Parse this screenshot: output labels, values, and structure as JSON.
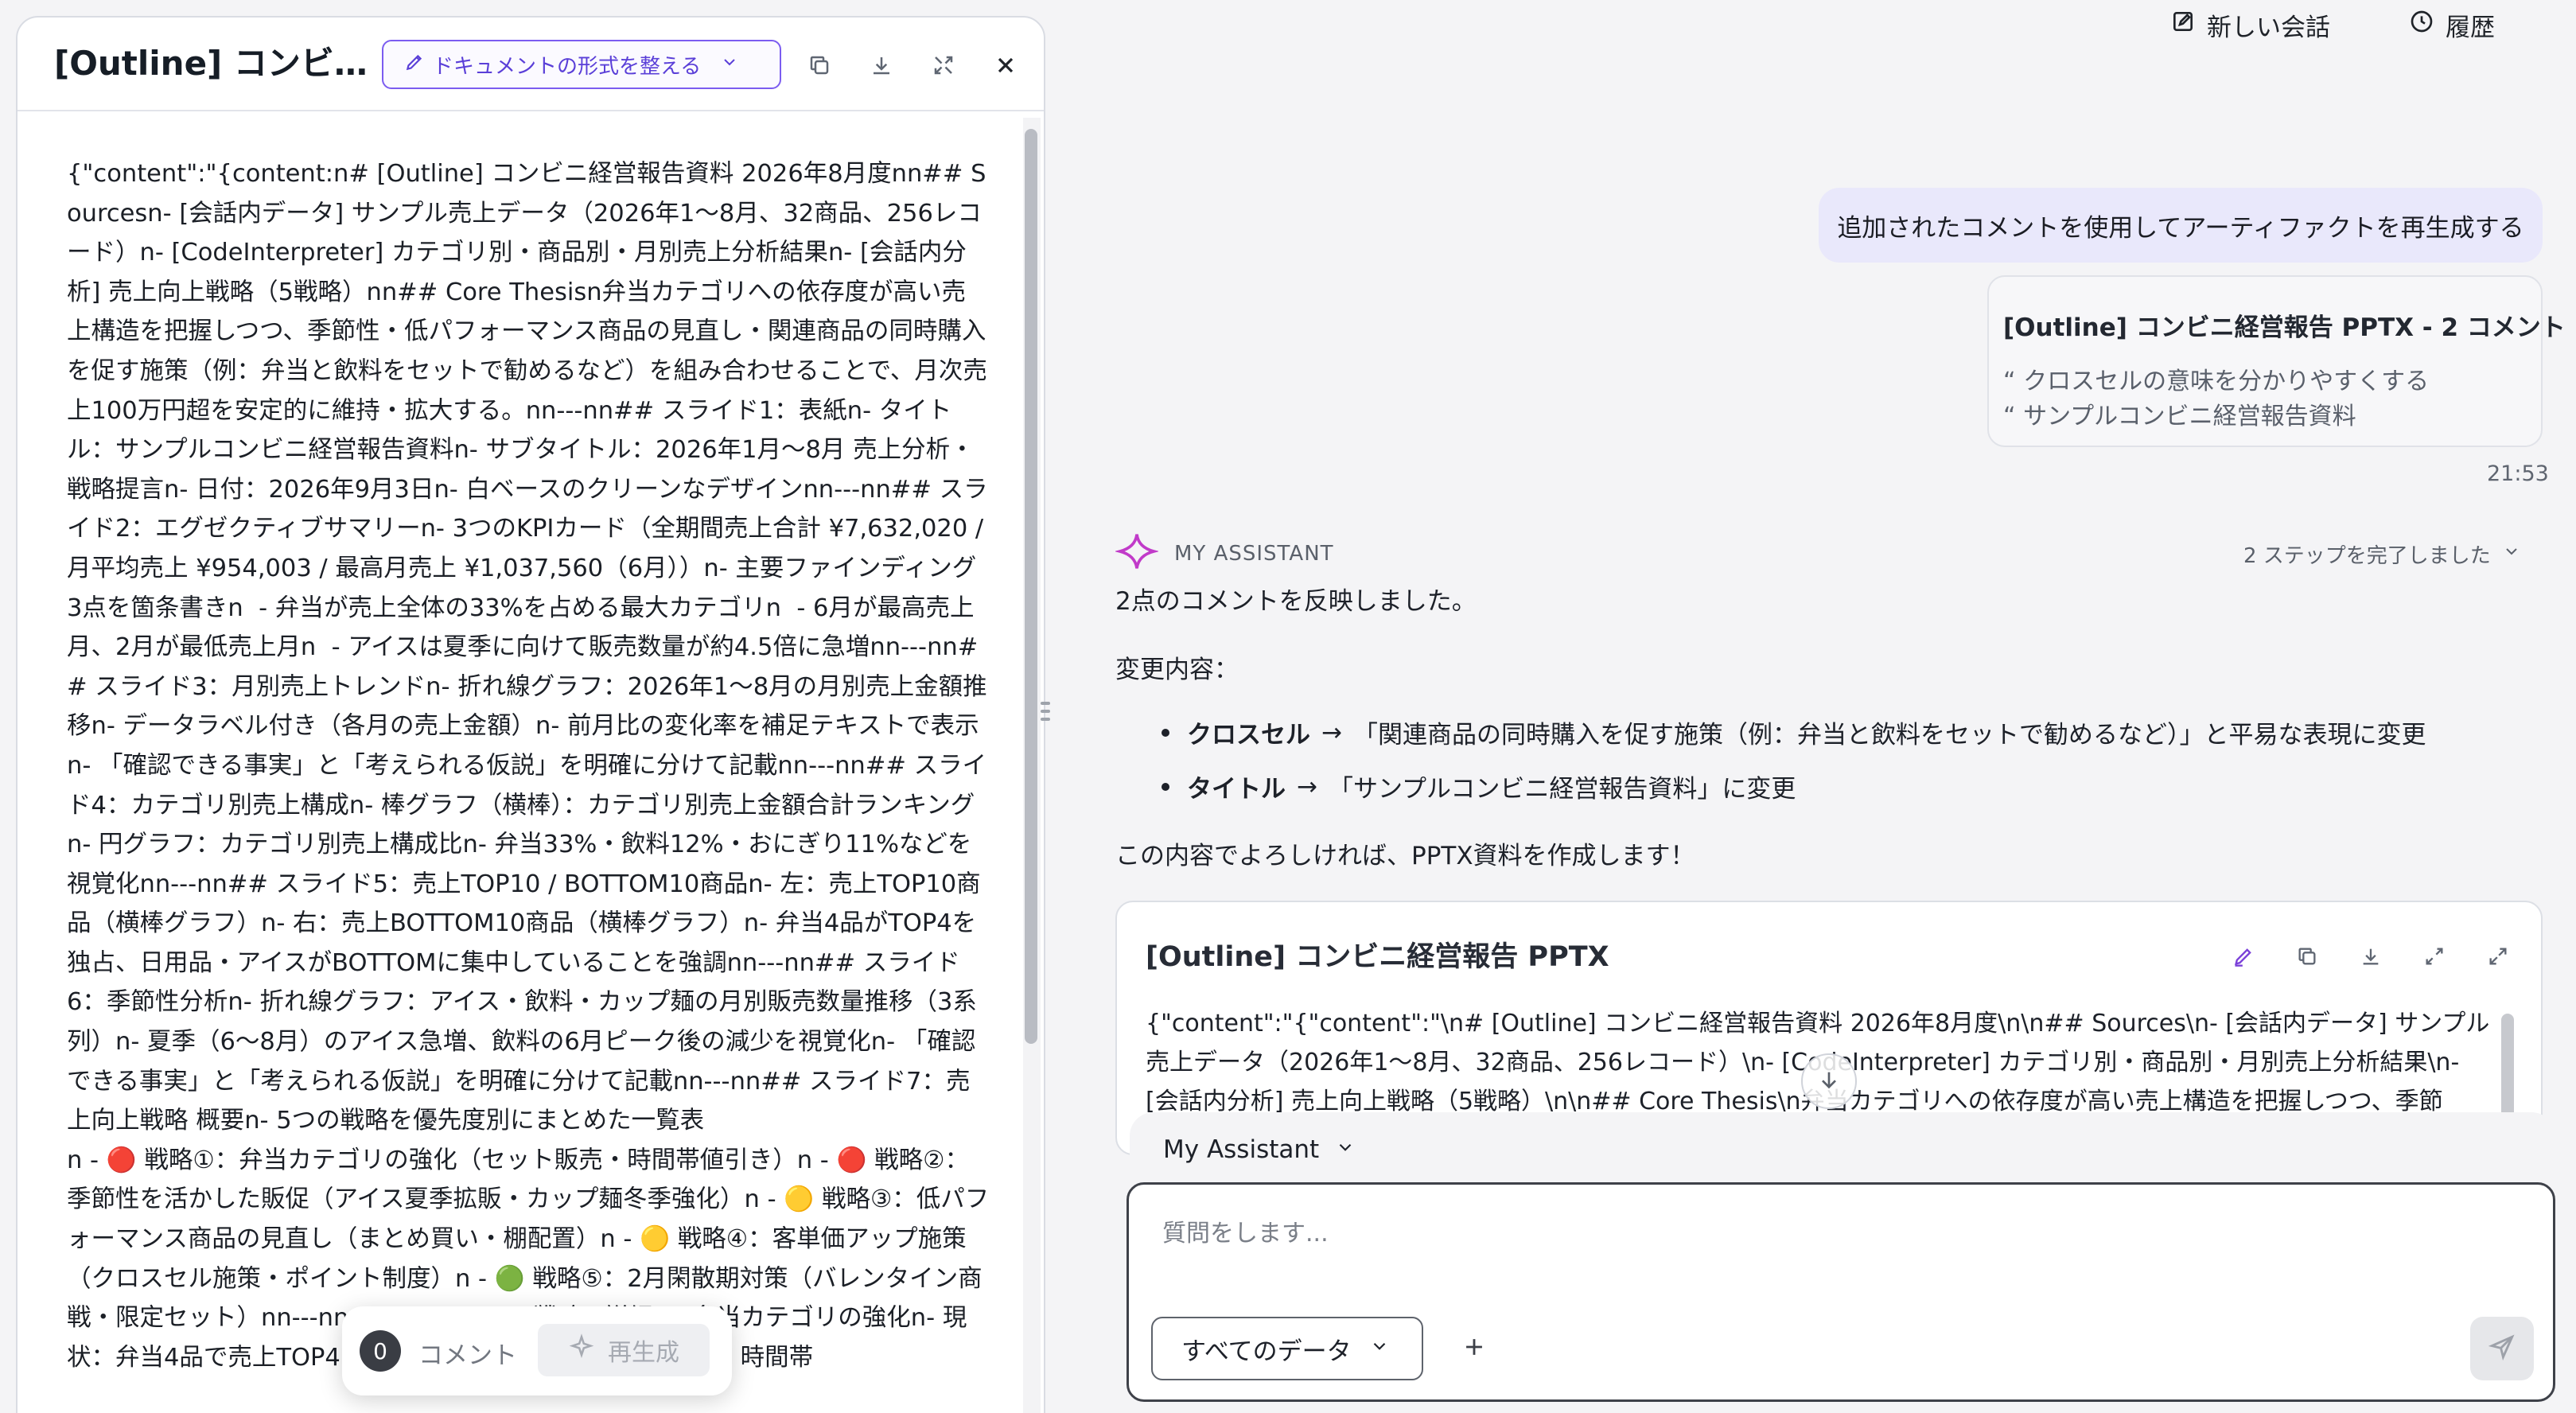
{
  "left_panel": {
    "title": "[Outline] コンビ…",
    "format_button_label": "ドキュメントの形式を整える",
    "content": "{\"content\":\"{content:n# [Outline] コンビニ経営報告資料 2026年8月度nn## Sourcesn- [会話内データ] サンプル売上データ（2026年1〜8月、32商品、256レコード）n- [CodeInterpreter] カテゴリ別・商品別・月別売上分析結果n- [会話内分析] 売上向上戦略（5戦略）nn## Core Thesisn弁当カテゴリへの依存度が高い売上構造を把握しつつ、季節性・低パフォーマンス商品の見直し・関連商品の同時購入を促す施策（例：弁当と飲料をセットで勧めるなど）を組み合わせることで、月次売上100万円超を安定的に維持・拡大する。nn---nn## スライド1：表紙n- タイトル：サンプルコンビニ経営報告資料n- サブタイトル：2026年1月〜8月 売上分析・戦略提言n- 日付：2026年9月3日n- 白ベースのクリーンなデザインnn---nn## スライド2：エグゼクティブサマリーn- 3つのKPIカード（全期間売上合計 ¥7,632,020 / 月平均売上 ¥954,003 / 最高月売上 ¥1,037,560（6月））n- 主要ファインディング3点を箇条書きn  - 弁当が売上全体の33%を占める最大カテゴリn  - 6月が最高売上月、2月が最低売上月n  - アイスは夏季に向けて販売数量が約4.5倍に急増nn---nn## スライド3：月別売上トレンドn- 折れ線グラフ：2026年1〜8月の月別売上金額推移n- データラベル付き（各月の売上金額）n- 前月比の変化率を補足テキストで表示n- 「確認できる事実」と「考えられる仮説」を明確に分けて記載nn---nn## スライド4：カテゴリ別売上構成n- 棒グラフ（横棒）：カテゴリ別売上金額合計ランキングn- 円グラフ：カテゴリ別売上構成比n- 弁当33%・飲料12%・おにぎり11%などを視覚化nn---nn## スライド5：売上TOP10 / BOTTOM10商品n- 左：売上TOP10商品（横棒グラフ）n- 右：売上BOTTOM10商品（横棒グラフ）n- 弁当4品がTOP4を独占、日用品・アイスがBOTTOMに集中していることを強調nn---nn## スライド6：季節性分析n- 折れ線グラフ：アイス・飲料・カップ麺の月別販売数量推移（3系列）n- 夏季（6〜8月）のアイス急増、飲料の6月ピーク後の減少を視覚化n- 「確認できる事実」と「考えられる仮説」を明確に分けて記載nn---nn## スライド7：売上向上戦略 概要n- 5つの戦略を優先度別にまとめた一覧表\nn - 🔴 戦略①：弁当カテゴリの強化（セット販売・時間帯値引き）n - 🔴 戦略②：季節性を活かした販促（アイス夏季拡販・カップ麺冬季強化）n - 🟡 戦略③：低パフォーマンス商品の見直し（まとめ買い・棚配置）n - 🟡 戦略④：客単価アップ施策（クロスセル施策・ポイント制度）n - 🟢 戦略⑤：2月閑散期対策（バレンタイン商戦・限定セット）nn---nn## スライド8：戦略①詳細 — 弁当カテゴリの強化n- 現状：弁当4品で売上TOP4を独占、全体の33%n- アクション：時間帯",
    "comment_count": "0",
    "comment_label": "コメント",
    "regenerate_label": "再生成"
  },
  "header": {
    "new_chat_label": "新しい会話",
    "history_label": "履歴"
  },
  "user_message": {
    "text": "追加されたコメントを使用してアーティファクトを再生成する",
    "ref_title": "[Outline] コンビニ経営報告 PPTX - 2 コメント",
    "ref_comments": [
      "“ クロスセルの意味を分かりやすくする",
      "“ サンプルコンビニ経営報告資料"
    ],
    "time": "21:53"
  },
  "assistant": {
    "name": "MY ASSISTANT",
    "steps_label": "2 ステップを完了しました",
    "intro": "2点のコメントを反映しました。",
    "changes_heading": "変更内容：",
    "changes": [
      {
        "term": "クロスセル",
        "arrow": "→",
        "desc": "「関連商品の同時購入を促す施策（例：弁当と飲料をセットで勧めるなど）」と平易な表現に変更"
      },
      {
        "term": "タイトル",
        "arrow": "→",
        "desc": "「サンプルコンビニ経営報告資料」に変更"
      }
    ],
    "closing": "この内容でよろしければ、PPTX資料を作成します！"
  },
  "artifact": {
    "title": "[Outline] コンビニ経営報告 PPTX",
    "content": "{\"content\":\"{\"content\":\"\\n# [Outline] コンビニ経営報告資料 2026年8月度\\n\\n## Sources\\n- [会話内データ] サンプル売上データ（2026年1〜8月、32商品、256レコード）\\n- [CodeInterpreter] カテゴリ別・商品別・月別売上分析結果\\n- [会話内分析] 売上向上戦略（5戦略）\\n\\n## Core Thesis\\n弁当カテゴリへの依存度が高い売上構造を把握しつつ、季節"
  },
  "composer": {
    "agent_label": "My Assistant",
    "placeholder": "質問をします...",
    "scope_label": "すべてのデータ"
  }
}
